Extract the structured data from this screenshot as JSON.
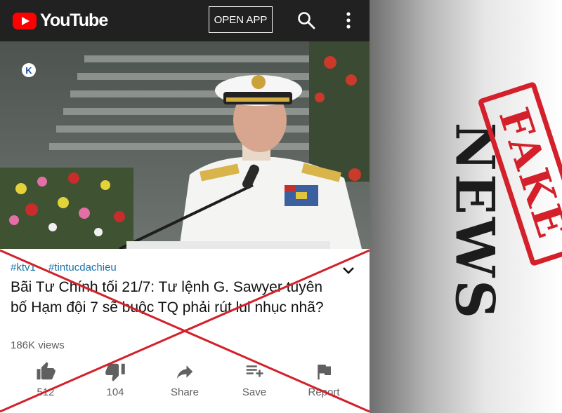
{
  "header": {
    "brand": "YouTube",
    "open_app_label": "OPEN APP",
    "icons": [
      "search-icon",
      "more-vert-icon"
    ]
  },
  "video": {
    "watermark": "K"
  },
  "details": {
    "tags": [
      "#ktv1",
      "#tintucdachieu"
    ],
    "title": "Bãi Tư Chính tối 21/7: Tư lệnh G. Sawyer tuyên bố Hạm đội 7 sẽ buộc TQ phải rút lui nhục nhã?",
    "views": "186K views"
  },
  "actions": {
    "like_count": "512",
    "dislike_count": "104",
    "share_label": "Share",
    "save_label": "Save",
    "report_label": "Report"
  },
  "overlay": {
    "news_word": "NEWS",
    "stamp_word": "FAKE",
    "cross_color": "#d3202a"
  },
  "colors": {
    "topbar": "#212121",
    "brand_red": "#ff0000",
    "tag_blue": "#1a73a8"
  }
}
